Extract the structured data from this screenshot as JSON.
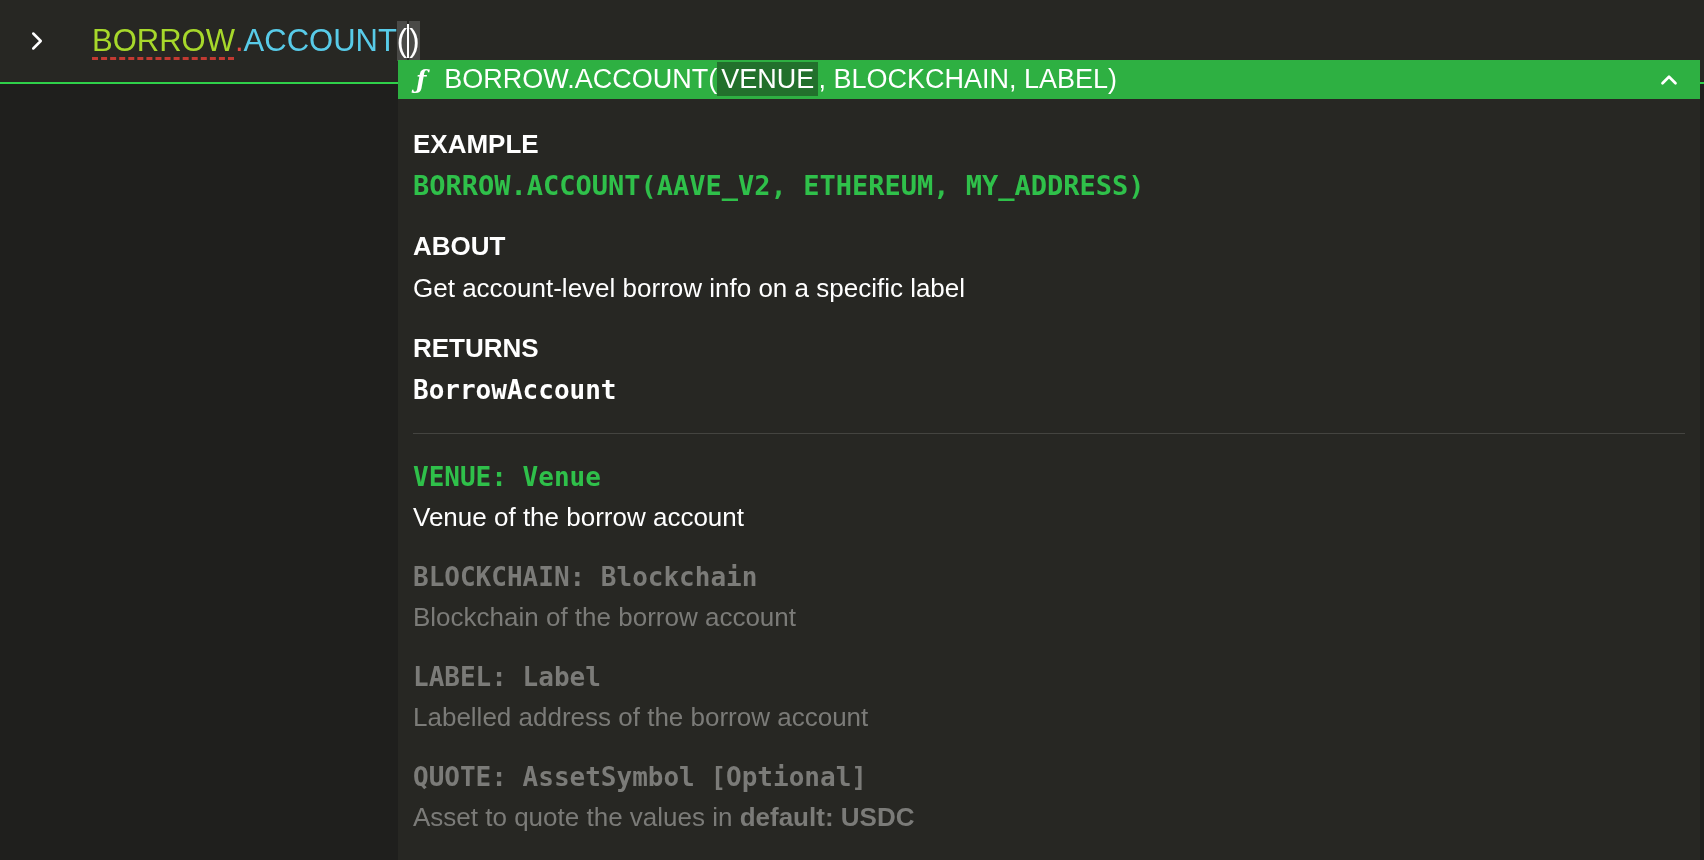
{
  "prompt": {
    "tokens": [
      {
        "text": "BORROW",
        "kind": "namespace"
      },
      {
        "text": ".",
        "kind": "dot"
      },
      {
        "text": "ACCOUNT",
        "kind": "function"
      },
      {
        "text": "(",
        "kind": "open"
      },
      {
        "text": ")",
        "kind": "close"
      }
    ]
  },
  "popup": {
    "icon": "ƒ",
    "name": "BORROW.ACCOUNT",
    "open": "(",
    "separator": ", ",
    "close": ")",
    "expanded": true,
    "sections": [
      {
        "heading": "EXAMPLE",
        "body": "BORROW.ACCOUNT(AAVE_V2, ETHEREUM, MY_ADDRESS)",
        "kind": "example"
      },
      {
        "heading": "ABOUT",
        "body": "Get account-level borrow info on a specific label",
        "kind": "text"
      },
      {
        "heading": "RETURNS",
        "body": "BorrowAccount",
        "kind": "type"
      }
    ],
    "signature_params": [
      {
        "text": "VENUE",
        "selected": true
      },
      {
        "text": "BLOCKCHAIN",
        "selected": false
      },
      {
        "text": "LABEL",
        "selected": false
      }
    ],
    "params": [
      {
        "signature": "VENUE: Venue",
        "description": "Venue of the borrow account",
        "selected": true
      },
      {
        "signature": "BLOCKCHAIN: Blockchain",
        "description": "Blockchain of the borrow account",
        "selected": false
      },
      {
        "signature": "LABEL: Label",
        "description": "Labelled address of the borrow account",
        "selected": false
      },
      {
        "signature": "QUOTE: AssetSymbol [Optional]",
        "description": "Asset to quote the values in **default: USDC**",
        "selected": false
      }
    ]
  }
}
